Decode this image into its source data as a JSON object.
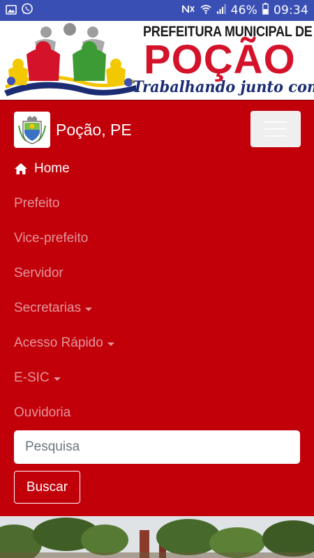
{
  "status_bar": {
    "battery": "46%",
    "time": "09:34",
    "background": "#3a4fb4"
  },
  "banner": {
    "title": "PREFEITURA MUNICIPAL DE",
    "city": "POÇÃO",
    "slogan": "Trabalhando junto com o povo!",
    "colors": {
      "city": "#d4122a",
      "slogan": "#1b2c73"
    }
  },
  "navbar": {
    "background": "#c1000a",
    "brand": {
      "name": "Poção, PE",
      "logo_icon": "municipal-coat-of-arms"
    },
    "toggler_icon": "hamburger-menu-icon",
    "items": [
      {
        "label": "Home",
        "active": true,
        "icon": "home-icon"
      },
      {
        "label": "Prefeito"
      },
      {
        "label": "Vice-prefeito"
      },
      {
        "label": "Servidor"
      },
      {
        "label": "Secretarias",
        "dropdown": true
      },
      {
        "label": "Acesso Rápido",
        "dropdown": true
      },
      {
        "label": "E-SIC",
        "dropdown": true
      },
      {
        "label": "Ouvidoria"
      }
    ]
  },
  "search": {
    "placeholder": "Pesquisa",
    "value": "",
    "button_label": "Buscar"
  }
}
